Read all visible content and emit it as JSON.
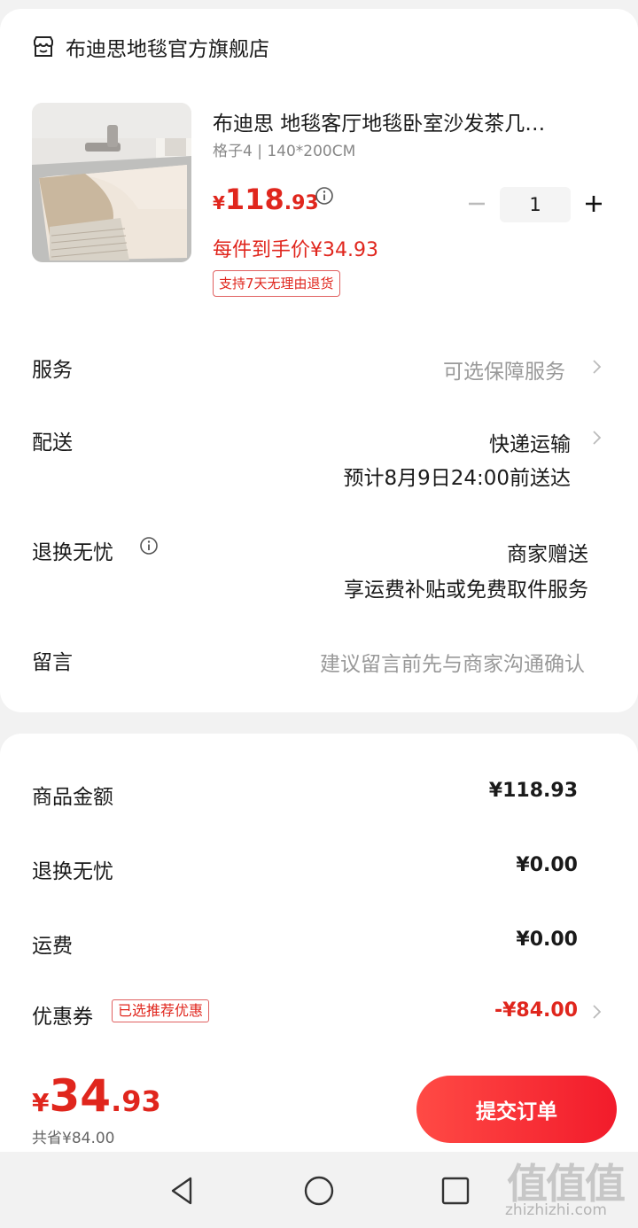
{
  "store": {
    "name": "布迪思地毯官方旗舰店",
    "icon": "store-icon"
  },
  "product": {
    "title": "布迪思 地毯客厅地毯卧室沙发茶几…",
    "spec": "格子4 | 140*200CM",
    "price_currency": "¥",
    "price_int": "118",
    "price_dec": ".93",
    "net_price": "每件到手价¥34.93",
    "return_tag": "支持7天无理由退货",
    "quantity": "1"
  },
  "rows": {
    "service_label": "服务",
    "service_value": "可选保障服务",
    "delivery_label": "配送",
    "delivery_value": "快递运输",
    "delivery_eta": "预计8月9日24:00前送达",
    "return_label": "退换无忧",
    "return_value": "商家赠送",
    "return_desc": "享运费补贴或免费取件服务",
    "note_label": "留言",
    "note_placeholder": "建议留言前先与商家沟通确认"
  },
  "summary": {
    "goods_label": "商品金额",
    "goods_value": "¥118.93",
    "return_label": "退换无忧",
    "return_value": "¥0.00",
    "shipping_label": "运费",
    "shipping_value": "¥0.00",
    "coupon_label": "优惠券",
    "coupon_tag": "已选推荐优惠",
    "coupon_value": "-¥84.00"
  },
  "footer": {
    "total_currency": "¥",
    "total_int": "34",
    "total_dec": ".93",
    "saved": "共省¥84.00",
    "submit_label": "提交订单"
  },
  "watermark": {
    "glyphs": "值值值",
    "url": "zhizhizhi.com"
  },
  "colors": {
    "accent_red": "#e0261d",
    "button_red": "#f21b2b",
    "background": "#f2f2f2"
  }
}
